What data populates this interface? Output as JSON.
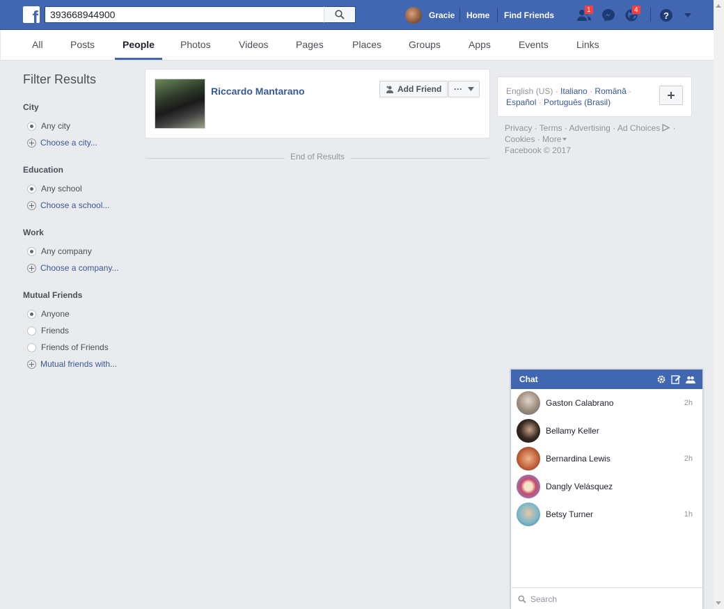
{
  "header": {
    "search_value": "393668944900",
    "profile_name": "Gracie",
    "home_label": "Home",
    "find_friends_label": "Find Friends",
    "friend_requests_badge": "1",
    "notifications_badge": "4",
    "logo_letter": "f"
  },
  "tabs": [
    {
      "label": "All"
    },
    {
      "label": "Posts"
    },
    {
      "label": "People",
      "active": true
    },
    {
      "label": "Photos"
    },
    {
      "label": "Videos"
    },
    {
      "label": "Pages"
    },
    {
      "label": "Places"
    },
    {
      "label": "Groups"
    },
    {
      "label": "Apps"
    },
    {
      "label": "Events"
    },
    {
      "label": "Links"
    }
  ],
  "filters": {
    "title": "Filter Results",
    "city": {
      "heading": "City",
      "selected": "Any city",
      "choose": "Choose a city..."
    },
    "education": {
      "heading": "Education",
      "selected": "Any school",
      "choose": "Choose a school..."
    },
    "work": {
      "heading": "Work",
      "selected": "Any company",
      "choose": "Choose a company..."
    },
    "mutual": {
      "heading": "Mutual Friends",
      "opt1": "Anyone",
      "opt2": "Friends",
      "opt3": "Friends of Friends",
      "choose": "Mutual friends with..."
    }
  },
  "result": {
    "name": "Riccardo Mantarano",
    "add_friend_label": "Add Friend",
    "more_label": "···"
  },
  "end_of_results": "End of Results",
  "languages": {
    "current": "English (US)",
    "others": [
      "Italiano",
      "Română",
      "Español",
      "Português (Brasil)"
    ]
  },
  "footer": {
    "privacy": "Privacy",
    "terms": "Terms",
    "advertising": "Advertising",
    "ad_choices": "Ad Choices",
    "cookies": "Cookies",
    "more": "More",
    "copyright": "Facebook © 2017"
  },
  "chat": {
    "title": "Chat",
    "contacts": [
      {
        "name": "Gaston Calabrano",
        "time": "2h"
      },
      {
        "name": "Bellamy Keller",
        "time": ""
      },
      {
        "name": "Bernardina Lewis",
        "time": "2h"
      },
      {
        "name": "Dangly Velásquez",
        "time": ""
      },
      {
        "name": "Betsy Turner",
        "time": "1h"
      }
    ],
    "search_placeholder": "Search"
  },
  "colors": {
    "brand_blue": "#4267b2",
    "link_blue": "#365899",
    "background": "#e9ebee",
    "badge_red": "#fa3e3e"
  }
}
